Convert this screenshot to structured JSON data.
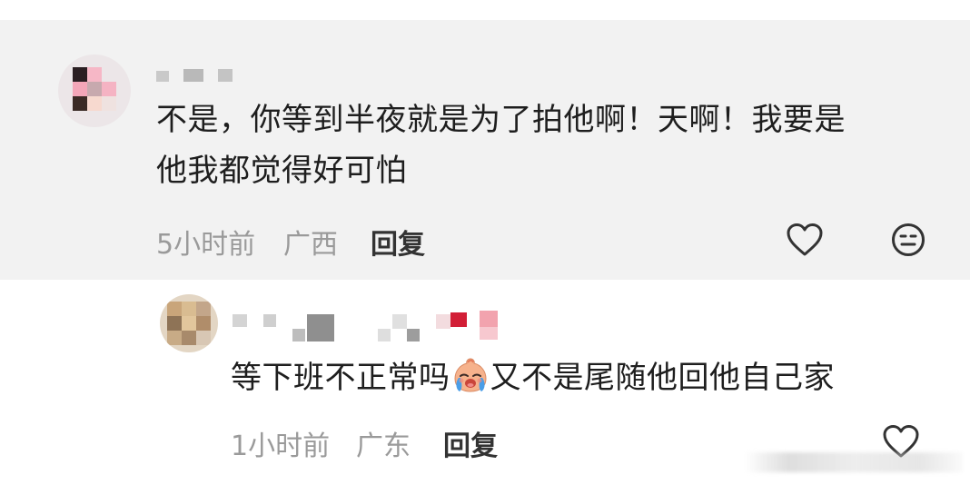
{
  "comment": {
    "text_line1": "不是，你等到半夜就是为了拍他啊！天啊！我要是",
    "text_line2": "他我都觉得好可怕",
    "time": "5小时前",
    "location": "广西",
    "reply_label": "回复",
    "like_icon": "heart-outline-icon",
    "dislike_icon": "meh-face-icon"
  },
  "reply": {
    "text_before_emoji": "等下班不正常吗",
    "emoji_icon": "crying-face-emoji",
    "text_after_emoji": "又不是尾随他回他自己家",
    "time": "1小时前",
    "location": "广东",
    "reply_label": "回复",
    "like_icon": "heart-outline-icon"
  },
  "colors": {
    "card_background": "#f2f2f2",
    "text": "#1e1e1e",
    "meta_text": "#9a9a9a"
  }
}
